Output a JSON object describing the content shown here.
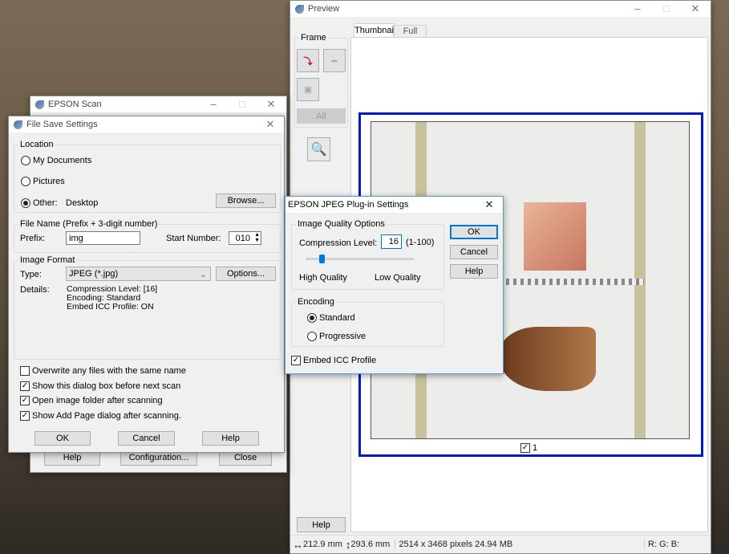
{
  "epson_scan": {
    "title": "EPSON Scan",
    "help": "Help",
    "configuration": "Configuration...",
    "close": "Close"
  },
  "file_save": {
    "title": "File Save Settings",
    "location": {
      "label": "Location",
      "options": [
        "My Documents",
        "Pictures",
        "Other:"
      ],
      "selected": "Other:",
      "other_value": "Desktop",
      "browse": "Browse..."
    },
    "file_name": {
      "label": "File Name (Prefix + 3-digit number)",
      "prefix_label": "Prefix:",
      "prefix_value": "img",
      "start_label": "Start Number:",
      "start_value": "010"
    },
    "image_format": {
      "label": "Image Format",
      "type_label": "Type:",
      "type_value": "JPEG (*.jpg)",
      "options": "Options...",
      "details_label": "Details:",
      "details": [
        "Compression Level: [16]",
        "Encoding: Standard",
        "Embed ICC Profile: ON"
      ]
    },
    "checkboxes": [
      {
        "label": "Overwrite any files with the same name",
        "checked": false
      },
      {
        "label": "Show this dialog box before next scan",
        "checked": true
      },
      {
        "label": "Open image folder after scanning",
        "checked": true
      },
      {
        "label": "Show Add Page dialog after scanning.",
        "checked": true
      }
    ],
    "ok": "OK",
    "cancel": "Cancel",
    "help": "Help"
  },
  "preview": {
    "title": "Preview",
    "frame_label": "Frame",
    "all": "All",
    "help": "Help",
    "tabs": [
      "Thumbnail",
      "Full Size"
    ],
    "active_tab": "Thumbnail",
    "thumb_index": "1",
    "thumb_checked": true,
    "status": {
      "width": "212.9 mm",
      "height": "293.6 mm",
      "info": "2514 x 3468 pixels 24.94 MB",
      "rgb": "R: G: B:"
    }
  },
  "jpeg": {
    "title": "EPSON JPEG Plug-in Settings",
    "quality_group": "Image Quality Options",
    "compression_label": "Compression Level:",
    "compression_value": "16",
    "range": "(1-100)",
    "slider_value": 16,
    "high": "High Quality",
    "low": "Low Quality",
    "encoding_group": "Encoding",
    "encodings": [
      "Standard",
      "Progressive"
    ],
    "encoding_selected": "Standard",
    "embed_icc": "Embed ICC Profile",
    "embed_checked": true,
    "ok": "OK",
    "cancel": "Cancel",
    "help": "Help"
  }
}
